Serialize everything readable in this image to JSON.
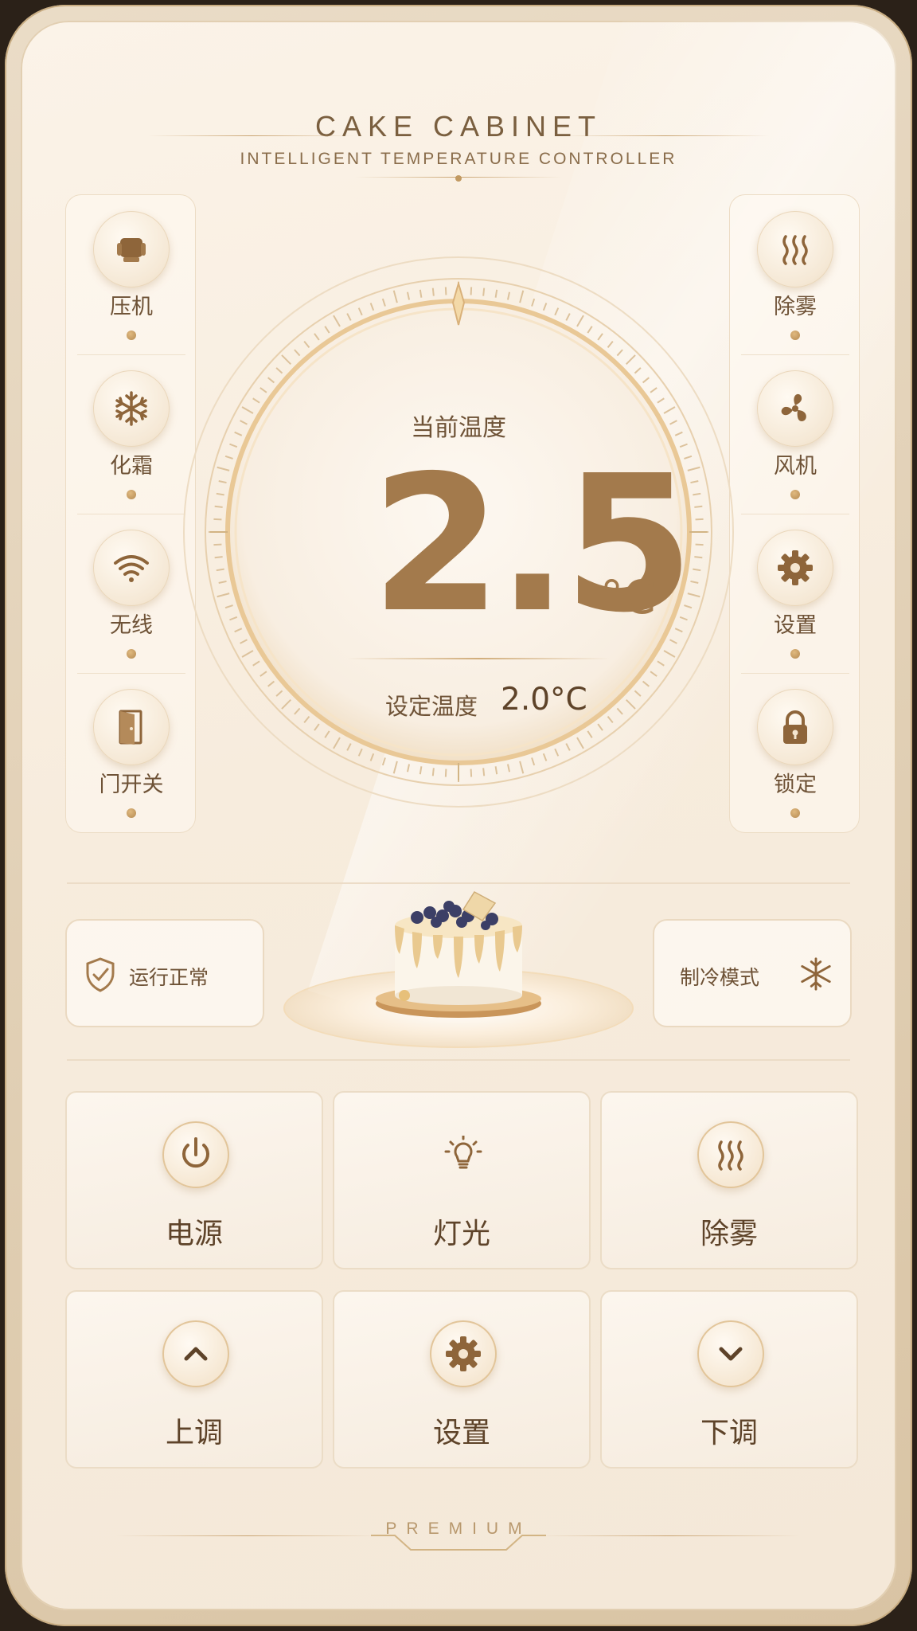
{
  "header": {
    "title": "CAKE CABINET",
    "subtitle": "INTELLIGENT TEMPERATURE CONTROLLER"
  },
  "left_panel": [
    {
      "label": "压机",
      "icon": "compressor-icon"
    },
    {
      "label": "化霜",
      "icon": "snowflake-icon"
    },
    {
      "label": "无线",
      "icon": "wifi-icon"
    },
    {
      "label": "门开关",
      "icon": "door-icon"
    }
  ],
  "right_panel": [
    {
      "label": "除雾",
      "icon": "defog-icon"
    },
    {
      "label": "风机",
      "icon": "fan-icon"
    },
    {
      "label": "设置",
      "icon": "gear-icon"
    },
    {
      "label": "锁定",
      "icon": "lock-icon"
    }
  ],
  "dial": {
    "current_label": "当前温度",
    "current_temp": "2.5",
    "unit": "°C",
    "set_label": "设定温度",
    "set_temp": "2.0°C"
  },
  "status": {
    "running": "运行正常",
    "mode": "制冷模式"
  },
  "buttons": [
    {
      "label": "电源",
      "icon": "power-icon"
    },
    {
      "label": "灯光",
      "icon": "light-bulb-icon"
    },
    {
      "label": "除雾",
      "icon": "defog-icon"
    },
    {
      "label": "上调",
      "icon": "chevron-up-icon"
    },
    {
      "label": "设置",
      "icon": "gear-icon"
    },
    {
      "label": "下调",
      "icon": "chevron-down-icon"
    }
  ],
  "footer": {
    "brand": "PREMIUM"
  },
  "colors": {
    "accent": "#a37a4c",
    "background": "#f7ecdd",
    "icon": "#8e653a"
  }
}
